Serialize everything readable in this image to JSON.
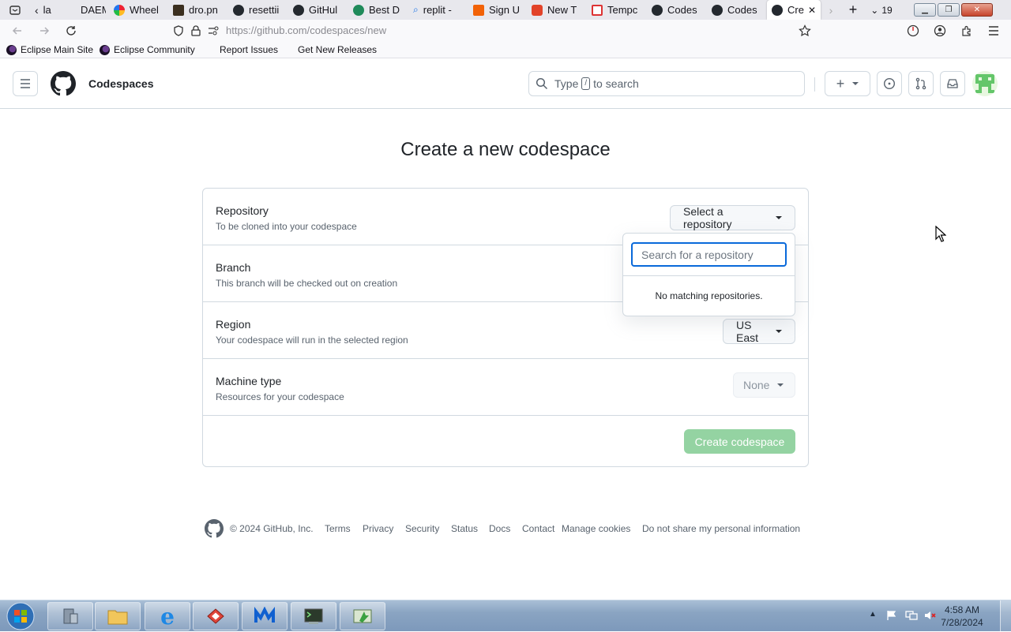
{
  "browser": {
    "tabs": [
      {
        "label": "la",
        "icon": "back-arrow-icon"
      },
      {
        "label": "DAEM",
        "icon": "blank-icon"
      },
      {
        "label": "Wheel",
        "icon": "wheel-icon"
      },
      {
        "label": "dro.pn",
        "icon": "dropbox-icon"
      },
      {
        "label": "resettii",
        "icon": "github-icon"
      },
      {
        "label": "GitHul",
        "icon": "github-icon"
      },
      {
        "label": "Best D",
        "icon": "green-circle-icon"
      },
      {
        "label": "replit -",
        "icon": "search-icon"
      },
      {
        "label": "Sign U",
        "icon": "orange-logo-icon"
      },
      {
        "label": "New T",
        "icon": "gitlab-icon"
      },
      {
        "label": "Tempc",
        "icon": "mail-icon"
      },
      {
        "label": "Codes",
        "icon": "github-icon"
      },
      {
        "label": "Codes",
        "icon": "github-icon"
      },
      {
        "label": "Cre",
        "icon": "github-icon",
        "active": true
      }
    ],
    "tab_count": "19",
    "url_host": "https://github.com",
    "url_path": "/codespaces/new",
    "bookmarks": [
      "Eclipse Main Site",
      "Eclipse Community",
      "Report Issues",
      "Get New Releases"
    ]
  },
  "header": {
    "title": "Codespaces",
    "search_pre": "Type",
    "search_key": "/",
    "search_post": "to search",
    "new_button": "+"
  },
  "main": {
    "title": "Create a new codespace",
    "rows": [
      {
        "title": "Repository",
        "desc": "To be cloned into your codespace",
        "control": "Select a repository"
      },
      {
        "title": "Branch",
        "desc": "This branch will be checked out on creation"
      },
      {
        "title": "Region",
        "desc": "Your codespace will run in the selected region",
        "control": "US East"
      },
      {
        "title": "Machine type",
        "desc": "Resources for your codespace",
        "control": "None"
      }
    ],
    "dropdown": {
      "placeholder": "Search for a repository",
      "empty_message": "No matching repositories."
    },
    "submit": "Create codespace"
  },
  "footer": {
    "copyright": "© 2024 GitHub, Inc.",
    "links": [
      "Terms",
      "Privacy",
      "Security",
      "Status",
      "Docs",
      "Contact",
      "Manage cookies",
      "Do not share my personal information"
    ]
  },
  "taskbar": {
    "time": "4:58 AM",
    "date": "7/28/2024"
  },
  "colors": {
    "accent": "#0969da",
    "create_button": "#94d3a2",
    "border": "#d1d9e0"
  }
}
